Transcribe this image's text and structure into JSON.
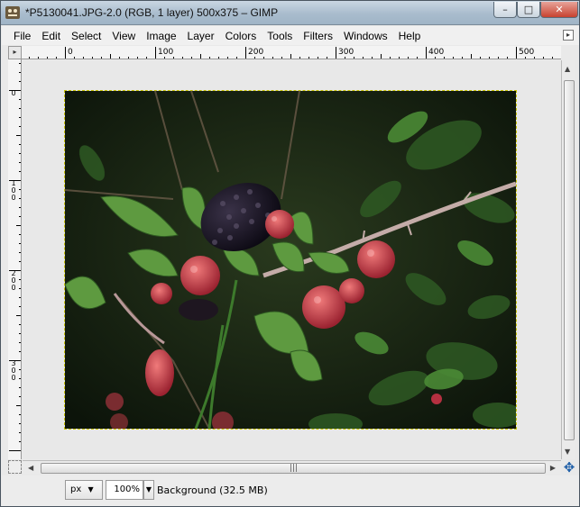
{
  "window": {
    "title": "*P5130041.JPG-2.0 (RGB, 1 layer) 500x375 – GIMP",
    "minimize_glyph": "–",
    "maximize_glyph": "□",
    "close_glyph": "✕"
  },
  "menubar": {
    "items": [
      "File",
      "Edit",
      "Select",
      "View",
      "Image",
      "Layer",
      "Colors",
      "Tools",
      "Filters",
      "Windows",
      "Help"
    ],
    "menu_arrow_glyph": "▸"
  },
  "rulers": {
    "horizontal_labels": [
      "0",
      "100",
      "200",
      "300",
      "400",
      "500"
    ],
    "vertical_labels": [
      "0",
      "100",
      "200",
      "300"
    ],
    "corner_glyph": "▸"
  },
  "image": {
    "subject": "blackberries",
    "colors": {
      "background": "#0f1a0c",
      "leaf": "#3f7a2e",
      "leaf_light": "#6ea24c",
      "ripe": "#1a1424",
      "unripe": "#c8404a",
      "stem": "#b8a0a0"
    }
  },
  "scrollbars": {
    "up_glyph": "▲",
    "down_glyph": "▼",
    "left_glyph": "◀",
    "right_glyph": "▶",
    "grip_glyph": "|||"
  },
  "statusbar": {
    "unit": "px",
    "unit_arrow": "▼",
    "zoom": "100%",
    "zoom_arrow": "▼",
    "status": "Background (32.5 MB)"
  },
  "icons": {
    "navigate_glyph": "✥"
  }
}
